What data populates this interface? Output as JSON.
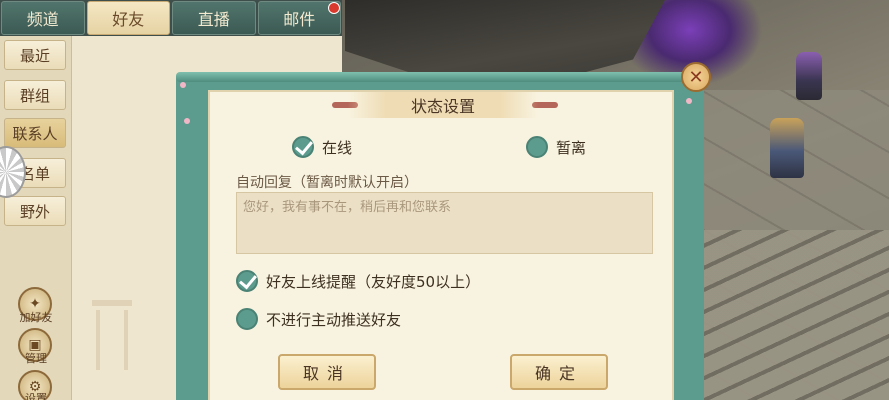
{
  "chat_tabs": [
    "频道",
    "好友",
    "直播",
    "邮件"
  ],
  "sidebar": {
    "items": [
      "最近",
      "群组",
      "联系人",
      "名单",
      "野外"
    ],
    "bottom_buttons": [
      {
        "label": "加好友",
        "glyph": "✦"
      },
      {
        "label": "管理",
        "glyph": "▣"
      },
      {
        "label": "设置",
        "glyph": "⚙"
      }
    ]
  },
  "dialog": {
    "title": "状态设置",
    "close_glyph": "✕",
    "status_online": "在线",
    "status_away": "暂离",
    "auto_reply_label": "自动回复（暂离时默认开启）",
    "auto_reply_placeholder": "您好，我有事不在，稍后再和您联系",
    "friend_online_alert": "好友上线提醒（友好度50以上）",
    "no_push_friends": "不进行主动推送好友",
    "cancel": "取消",
    "confirm": "确定"
  },
  "colors": {
    "accent": "#5c9c8e",
    "paper": "#f8f3e0",
    "tab_active": "#f5e7c4"
  }
}
